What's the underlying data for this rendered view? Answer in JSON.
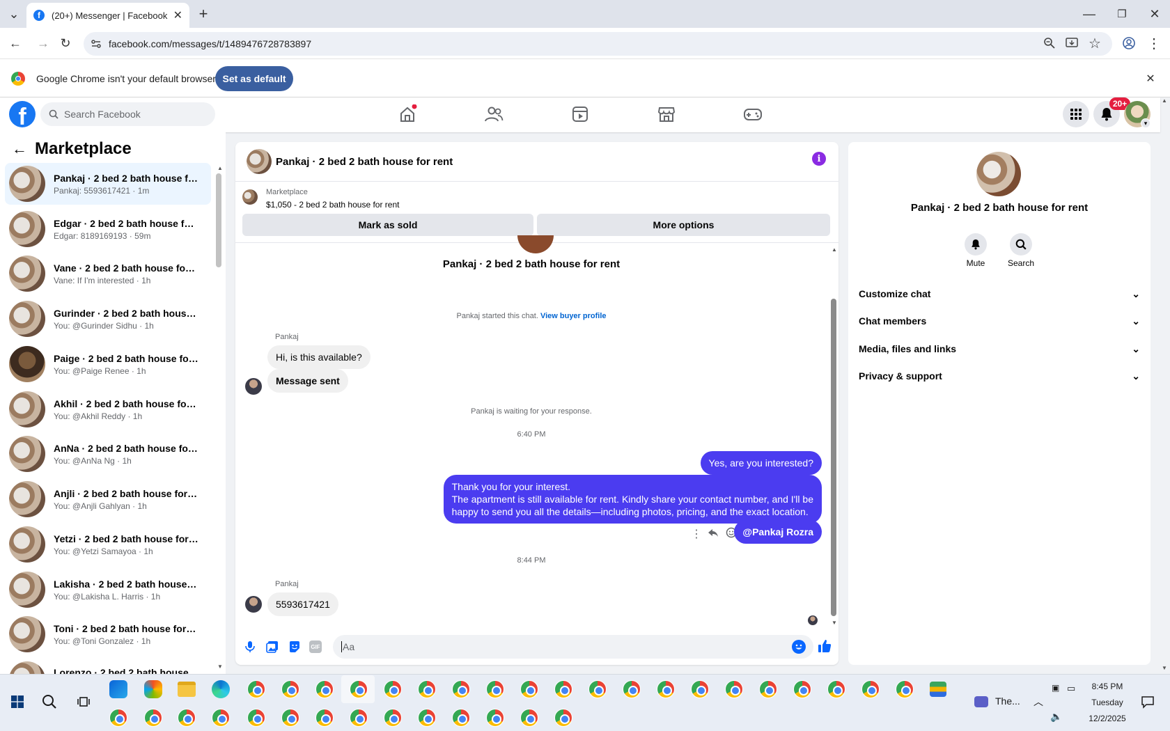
{
  "browser": {
    "tab_title": "(20+) Messenger | Facebook",
    "url": "facebook.com/messages/t/1489476728783897",
    "infobar_text": "Google Chrome isn't your default browser",
    "set_default_label": "Set as default"
  },
  "fb": {
    "search_placeholder": "Search Facebook",
    "notif_badge": "20+"
  },
  "sidebar": {
    "title": "Marketplace",
    "conversations": [
      {
        "name": "Pankaj · 2 bed 2 bath house for ...",
        "preview": "Pankaj: 5593617421 · 1m"
      },
      {
        "name": "Edgar · 2 bed 2 bath house for r...",
        "preview": "Edgar: 8189169193 · 59m"
      },
      {
        "name": "Vane · 2 bed 2 bath house for rent",
        "preview": "Vane: If I'm interested · 1h"
      },
      {
        "name": "Gurinder · 2 bed 2 bath house f...",
        "preview": "You: @Gurinder Sidhu · 1h"
      },
      {
        "name": "Paige · 2 bed 2 bath house for r...",
        "preview": "You: @Paige Renee · 1h"
      },
      {
        "name": "Akhil · 2 bed 2 bath house for re...",
        "preview": "You: @Akhil Reddy · 1h"
      },
      {
        "name": "AnNa · 2 bed 2 bath house for r...",
        "preview": "You: @AnNa Ng · 1h"
      },
      {
        "name": "Anjli · 2 bed 2 bath house for rent",
        "preview": "You: @Anjli Gahlyan · 1h"
      },
      {
        "name": "Yetzi · 2 bed 2 bath house for rent",
        "preview": "You: @Yetzi Samayoa · 1h"
      },
      {
        "name": "Lakisha · 2 bed 2 bath house for...",
        "preview": "You: @Lakisha L. Harris · 1h"
      },
      {
        "name": "Toni · 2 bed 2 bath house for rent",
        "preview": "You: @Toni Gonzalez · 1h"
      },
      {
        "name": "Lorenzo · 2 bed 2 bath house",
        "preview": ""
      }
    ]
  },
  "chat": {
    "header_title": "Pankaj · 2 bed 2 bath house for rent",
    "listing_label": "Marketplace",
    "listing_price": "$1,050 - 2 bed 2 bath house for rent",
    "mark_sold": "Mark as sold",
    "more_options": "More options",
    "intro_title": "Pankaj · 2 bed 2 bath house for rent",
    "started_text": "Pankaj started this chat.",
    "view_profile": "View buyer profile",
    "sender_name": "Pankaj",
    "msg1": "Hi, is this available?",
    "msg2": "Message sent",
    "waiting_text": "Pankaj is waiting for your response.",
    "time1": "6:40 PM",
    "out1": "Yes, are you interested?",
    "out2_line1": "Thank you for your interest.",
    "out2_line2": "The apartment is still available for rent. Kindly share your contact number, and I'll be",
    "out2_line3": "happy to send you all the details—including photos, pricing, and the exact location.",
    "out3": "@Pankaj Rozra",
    "time2": "8:44 PM",
    "sender_name2": "Pankaj",
    "msg3": "5593617421",
    "composer_placeholder": "Aa",
    "gif_label": "GIF"
  },
  "details": {
    "name": "Pankaj · 2 bed 2 bath house for rent",
    "mute_label": "Mute",
    "search_label": "Search",
    "sections": [
      "Customize chat",
      "Chat members",
      "Media, files and links",
      "Privacy & support"
    ]
  },
  "taskbar": {
    "pinned_label": "The...",
    "time": "8:45 PM",
    "day": "Tuesday",
    "date": "12/2/2025"
  },
  "colors": {
    "fb_blue": "#1877f2",
    "outgoing_bubble": "#4b3cf0",
    "info_purple": "#8a2be2"
  }
}
